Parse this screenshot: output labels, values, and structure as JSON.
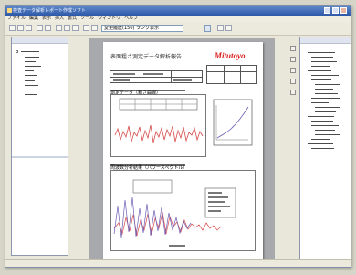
{
  "app": {
    "title": "検査データ解析レポート作成ソフト",
    "menus": [
      "ファイル",
      "編集",
      "表示",
      "挿入",
      "書式",
      "ツール",
      "ウィンドウ",
      "ヘルプ"
    ]
  },
  "toolbar": {
    "combo_value": "変更履歴(150) ランク表示",
    "buttons": [
      "new-file-icon",
      "open-folder-icon",
      "save-icon",
      "print-icon",
      "preview-icon",
      "cut-icon",
      "copy-icon",
      "paste-icon",
      "undo-icon",
      "redo-icon",
      "table-icon",
      "chart-icon"
    ]
  },
  "document": {
    "title": "表面粗さ測定データ解析報告",
    "logo": "Mitutoyo",
    "section1_label": "測定データ（粗さ曲線）",
    "section2_label": "周波数分析結果（パワースペクトル）"
  },
  "tree": {
    "left_items": 10,
    "right_items": 24
  },
  "colors": {
    "title_gradient_start": "#5d86c9",
    "title_gradient_end": "#2d58a8",
    "logo": "#d91f1f",
    "plot_red": "#d64b4b",
    "plot_purple": "#6b5bb5",
    "workspace": "#a7a9ad"
  }
}
